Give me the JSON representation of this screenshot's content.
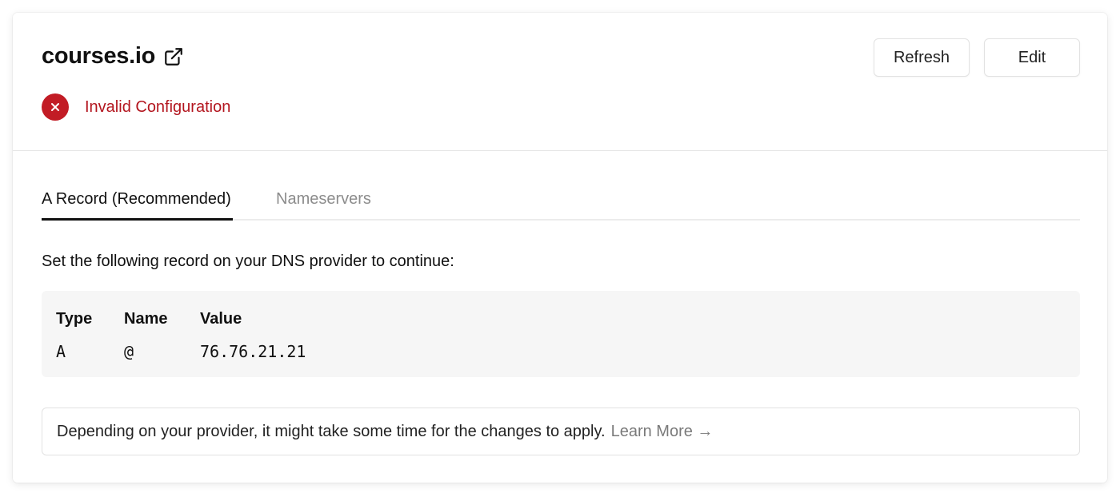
{
  "domain": {
    "name": "courses.io",
    "external_link_icon": "external-link-icon"
  },
  "status": {
    "label": "Invalid Configuration",
    "icon": "error-x-icon",
    "color": "#c21c25"
  },
  "actions": {
    "refresh_label": "Refresh",
    "edit_label": "Edit"
  },
  "tabs": [
    {
      "label": "A Record (Recommended)",
      "active": true
    },
    {
      "label": "Nameservers",
      "active": false
    }
  ],
  "instruction": "Set the following record on your DNS provider to continue:",
  "record": {
    "headers": [
      "Type",
      "Name",
      "Value"
    ],
    "row": [
      "A",
      "@",
      "76.76.21.21"
    ]
  },
  "notice": {
    "text": "Depending on your provider, it might take some time for the changes to apply.",
    "link_label": "Learn More →"
  }
}
